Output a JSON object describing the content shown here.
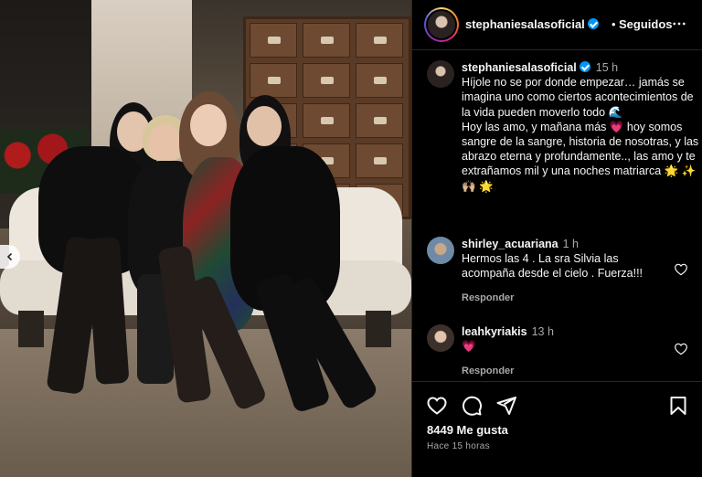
{
  "post": {
    "username": "stephaniesalasoficial",
    "follow_status": "Seguidos",
    "separator": "•"
  },
  "caption": {
    "username": "stephaniesalasoficial",
    "time": "15 h",
    "line1": "Híjole no se por donde empezar… jamás se imagina uno como ciertos acontecimientos de la vida pueden moverlo todo 🌊",
    "line2": "Hoy las amo, y mañana más 💗 hoy somos sangre de la sangre, historia de nosotras, y las abrazo eterna y profundamente.., las amo y te extrañamos mil y una noches matriarca 🌟 ✨ 🙌🏼 🌟"
  },
  "comments": [
    {
      "username": "shirley_acuariana",
      "time": "1 h",
      "text": "Hermos las 4 . La sra Silvia las acompaña desde el cielo . Fuerza!!!",
      "reply": "Responder"
    },
    {
      "username": "leahkyriakis",
      "time": "13 h",
      "text": "💗",
      "reply": "Responder"
    }
  ],
  "footer": {
    "likes": "8449 Me gusta",
    "ago": "Hace 15 horas"
  },
  "icons": {
    "more": "more-options-icon",
    "like": "heart-icon",
    "comment": "comment-icon",
    "share": "share-icon",
    "save": "bookmark-icon",
    "prev": "chevron-left-icon"
  },
  "colors": {
    "verified": "#0095f6",
    "secondary_text": "#a8a8a8"
  }
}
